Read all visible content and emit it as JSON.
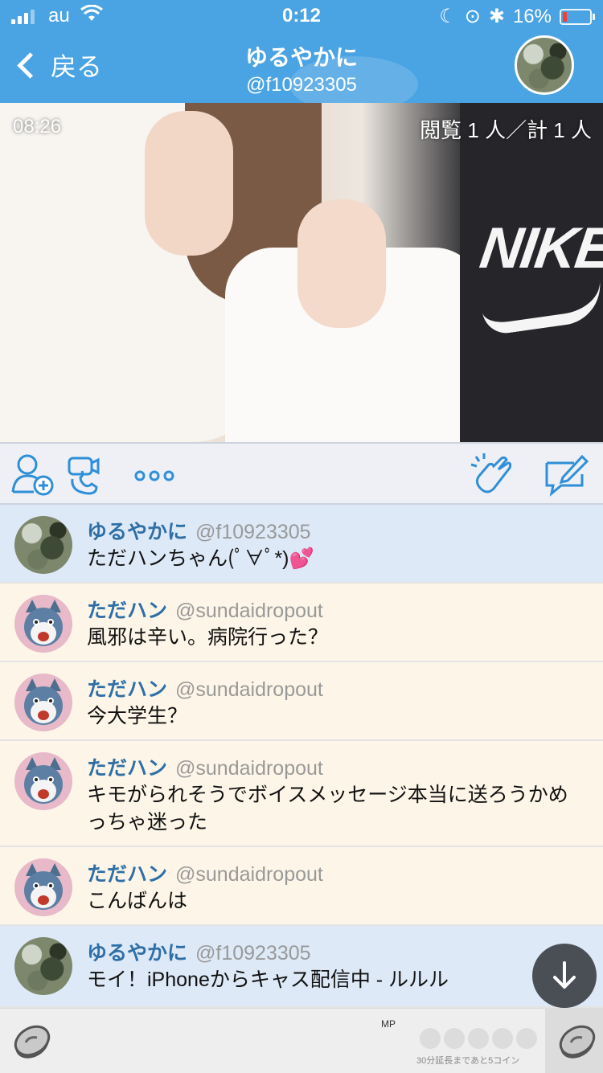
{
  "status_bar": {
    "carrier": "au",
    "time": "0:12",
    "battery_percent": "16%",
    "battery_level": 0.16
  },
  "header": {
    "back_label": "戻る",
    "broadcaster_name": "ゆるやかに",
    "broadcaster_handle": "@f10923305"
  },
  "video": {
    "elapsed": "08:26",
    "viewers": "閲覧 1 人／計 1 人",
    "overlay_text": "NIKE"
  },
  "toolbar": {
    "icons": [
      "add-user-icon",
      "video-call-icon",
      "more-icon",
      "applause-icon",
      "compose-icon"
    ]
  },
  "comments": [
    {
      "name": "ゆるやかに",
      "handle": "@f10923305",
      "text": "ただハンちゃん(ﾟ∀ﾟ*)💕",
      "kind": "self"
    },
    {
      "name": "ただハン",
      "handle": "@sundaidropout",
      "text": "風邪は辛い。病院行った？",
      "kind": "other"
    },
    {
      "name": "ただハン",
      "handle": "@sundaidropout",
      "text": "今大学生？",
      "kind": "other"
    },
    {
      "name": "ただハン",
      "handle": "@sundaidropout",
      "text": "キモがられそうでボイスメッセージ本当に送ろうかめっちゃ迷った",
      "kind": "other"
    },
    {
      "name": "ただハン",
      "handle": "@sundaidropout",
      "text": "こんばんは",
      "kind": "other"
    },
    {
      "name": "ゆるやかに",
      "handle": "@f10923305",
      "text": "モイ！iPhoneからキャス配信中 - ルルル",
      "kind": "self"
    }
  ],
  "bottom": {
    "mp_label": "MP",
    "extend_text": "30分延長まであと5コイン",
    "coin_slots": 5
  },
  "colors": {
    "header_blue": "#4aa3e3",
    "self_comment_bg": "#dde9f7",
    "other_comment_bg": "#fdf6e8",
    "name_blue": "#2f6fa6",
    "icon_blue": "#2f8fd8"
  }
}
